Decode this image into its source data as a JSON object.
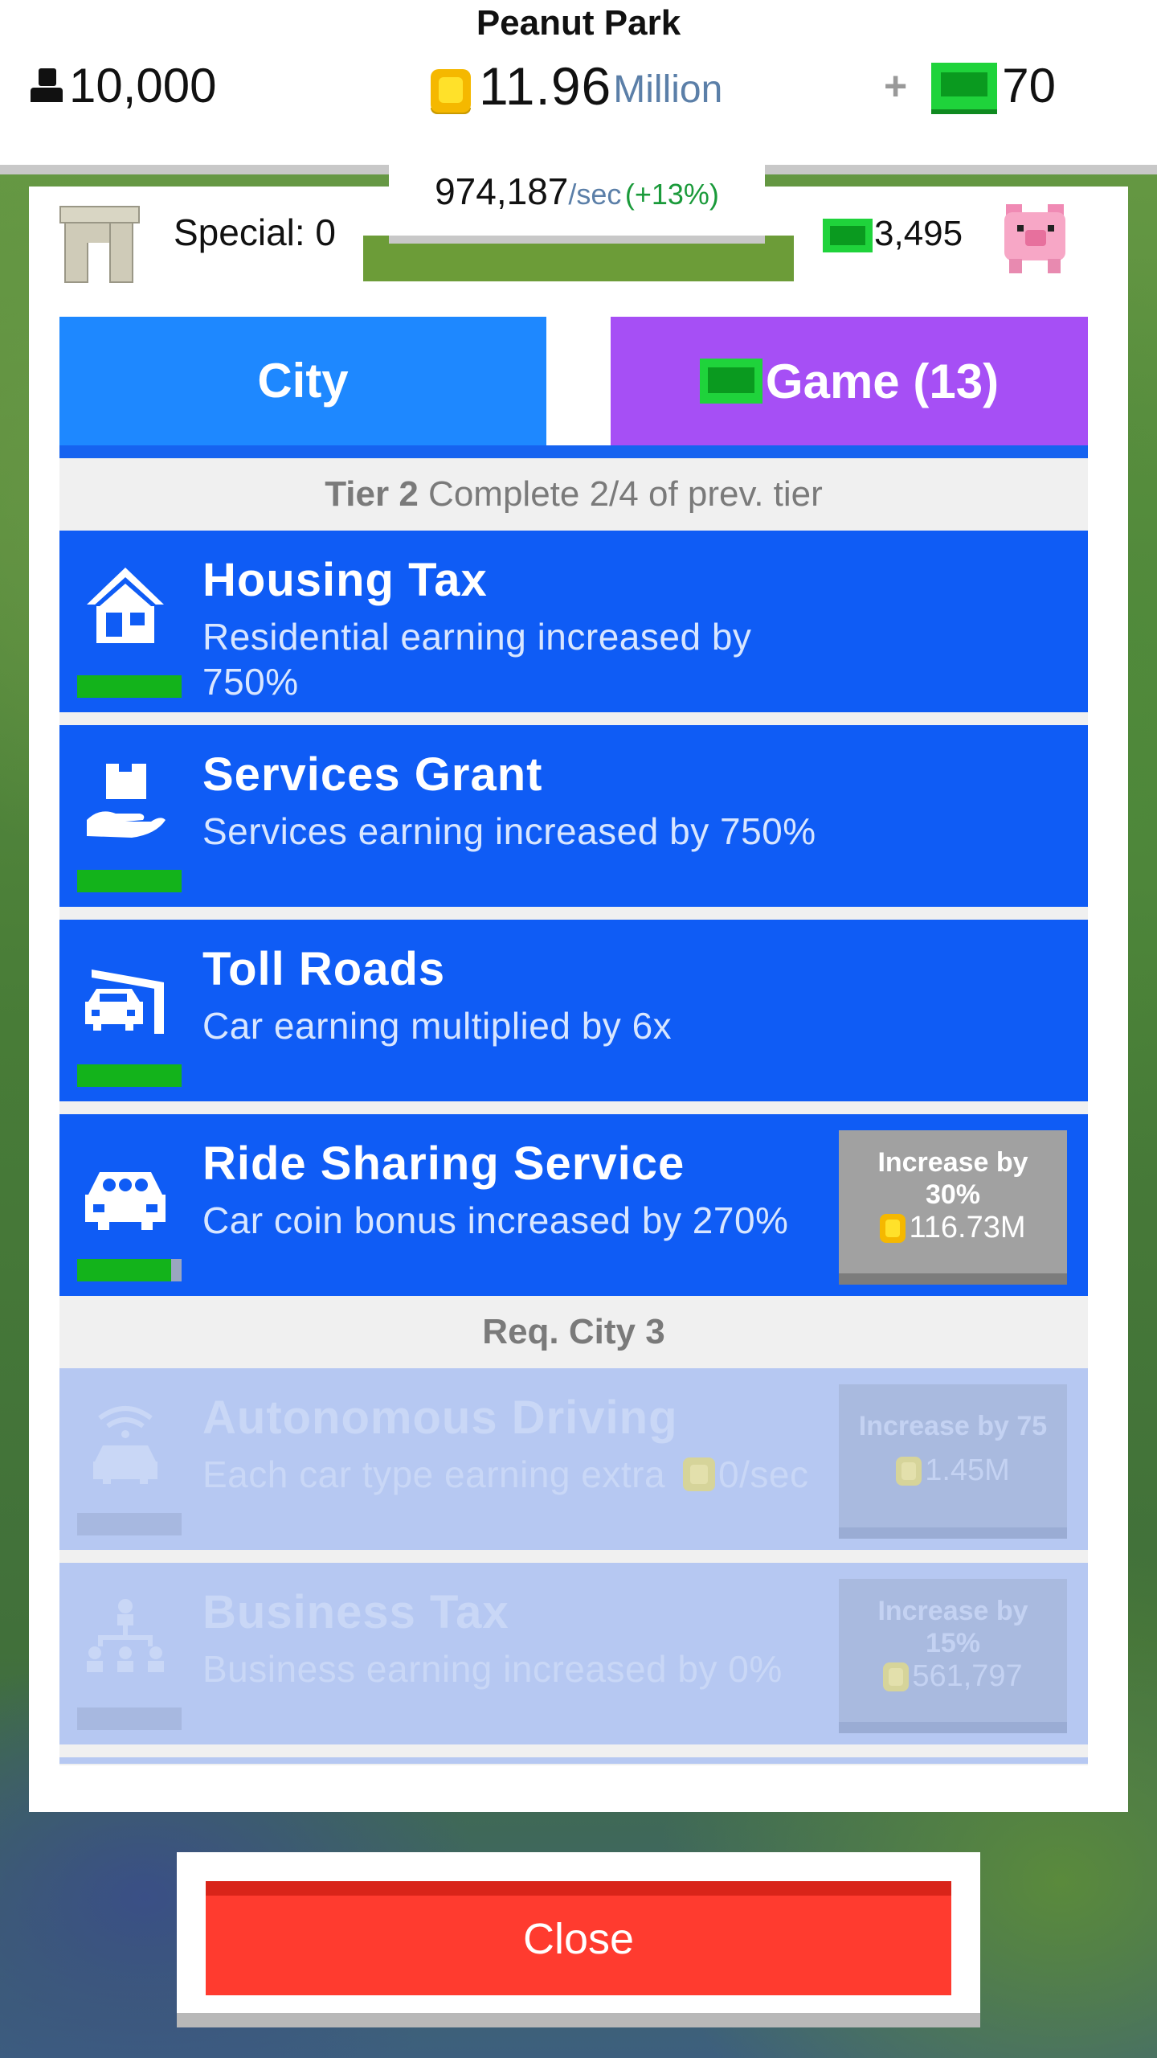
{
  "header": {
    "city_name": "Peanut Park",
    "population": "10,000",
    "coins_value": "11.96",
    "coins_unit": "Million",
    "cash_plus": "+",
    "cash_value": "70"
  },
  "income": {
    "rate": "974,187",
    "per": "/sec",
    "bonus": "(+13%)"
  },
  "special": {
    "label": "Special: 0"
  },
  "piggy_bank": {
    "value": "3,495"
  },
  "tabs": {
    "city": "City",
    "game": "Game (13)"
  },
  "tier": {
    "name": "Tier 2",
    "requirement": "Complete 2/4 of prev. tier"
  },
  "upgrades": [
    {
      "title": "Housing Tax",
      "desc": "Residential earning increased by 750%",
      "icon": "house-icon",
      "progress": 1.0
    },
    {
      "title": "Services Grant",
      "desc": "Services earning increased by 750%",
      "icon": "hand-box-icon",
      "progress": 1.0
    },
    {
      "title": "Toll Roads",
      "desc": "Car earning multiplied by 6x",
      "icon": "toll-gate-icon",
      "progress": 1.0
    },
    {
      "title": "Ride Sharing Service",
      "desc": "Car coin bonus increased by 270%",
      "icon": "car-passengers-icon",
      "progress": 0.9,
      "button_l1": "Increase by",
      "button_l2": "30%",
      "button_cost": "116.73M"
    }
  ],
  "locked_header": "Req. City 3",
  "locked_upgrades": [
    {
      "title": "Autonomous Driving",
      "desc": "Each car type earning extra",
      "desc_value": "0/sec",
      "icon": "autonomous-car-icon",
      "button_l1": "Increase by 75",
      "button_cost": "1.45M"
    },
    {
      "title": "Business Tax",
      "desc": "Business earning increased by 0%",
      "icon": "org-chart-icon",
      "button_l1": "Increase by",
      "button_l2": "15%",
      "button_cost": "561,797"
    }
  ],
  "close_button": "Close",
  "colors": {
    "card_blue": "#0f5cf5",
    "tab_city": "#1e88ff",
    "tab_game": "#a64ff5",
    "close_red": "#ff3b2f",
    "progress_green": "#13b31b"
  }
}
